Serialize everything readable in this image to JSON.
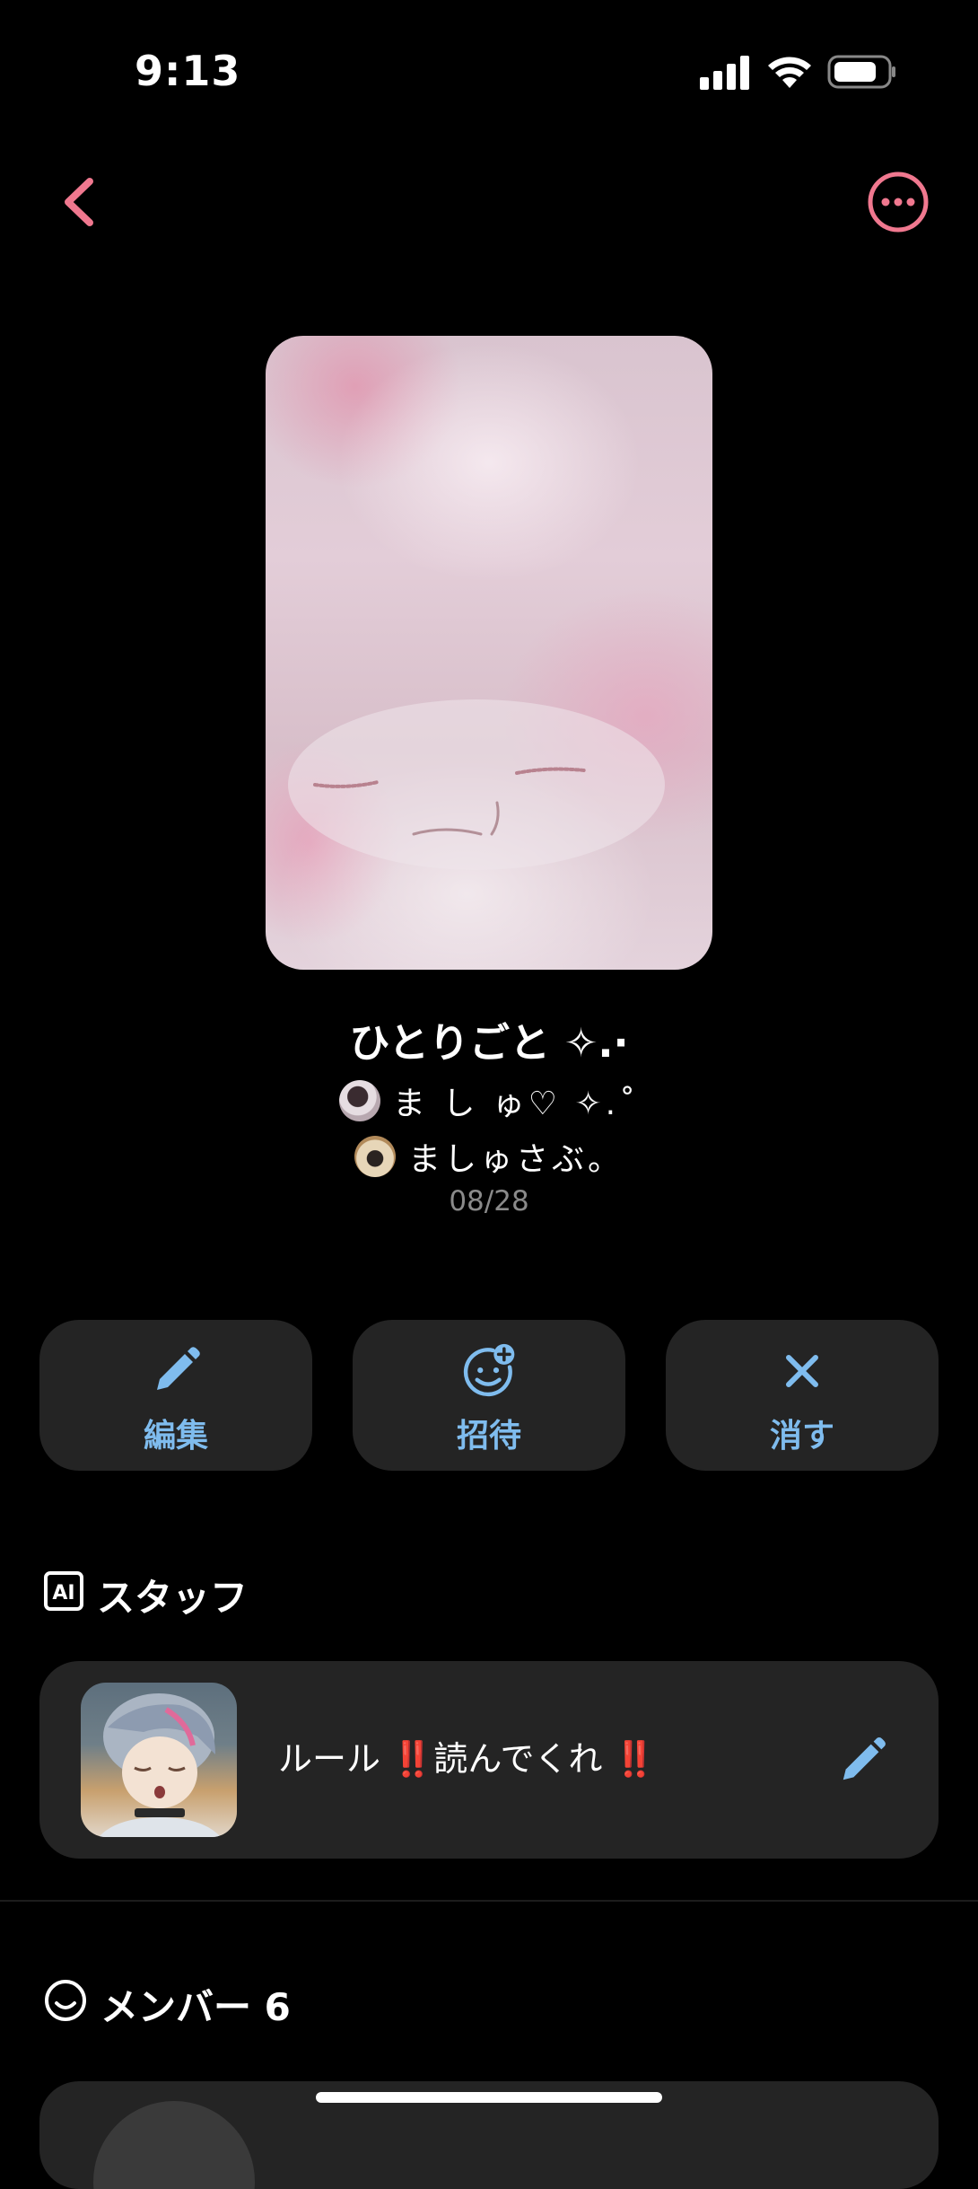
{
  "status_bar": {
    "time": "9:13",
    "icons": [
      "signal-icon",
      "wifi-icon",
      "battery-icon"
    ]
  },
  "nav": {
    "back_icon": "chevron-left-icon",
    "more_icon": "more-circle-icon",
    "accent_color": "#f0788f"
  },
  "room": {
    "title": "ひとりごと ✧.·",
    "owners": [
      {
        "name": "ま し ゅ♡ ✧.˚"
      },
      {
        "name": "ましゅさぶ。"
      }
    ],
    "date": "08/28"
  },
  "actions": {
    "edit_label": "編集",
    "invite_label": "招待",
    "delete_label": "消す",
    "accent_color": "#7fbcee"
  },
  "staff": {
    "header": "スタッフ",
    "badge": "AI",
    "rule_text": "ルール ‼️読んでくれ ‼️"
  },
  "members": {
    "header": "メンバー 6"
  }
}
